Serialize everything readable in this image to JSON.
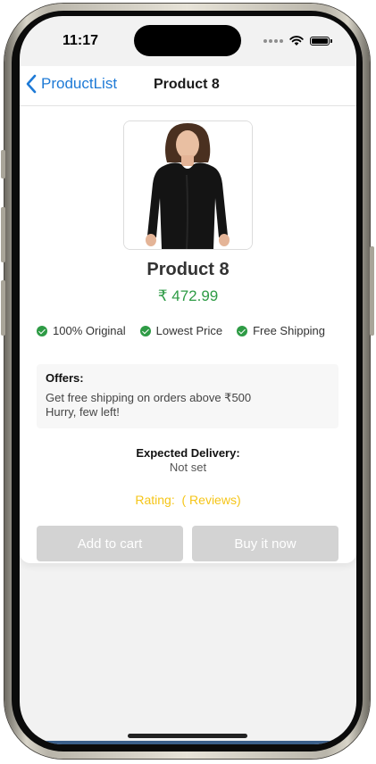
{
  "status_bar": {
    "time": "11:17",
    "icons": [
      "signal-dots-icon",
      "wifi-icon",
      "battery-icon"
    ]
  },
  "navbar": {
    "back_label": "ProductList",
    "title": "Product 8"
  },
  "product": {
    "image_icon": "black-long-sleeve-top-image",
    "name": "Product 8",
    "price": "₹ 472.99"
  },
  "features": [
    {
      "label": "100% Original",
      "icon": "check-circle-icon"
    },
    {
      "label": "Lowest Price",
      "icon": "check-circle-icon"
    },
    {
      "label": "Free Shipping",
      "icon": "check-circle-icon"
    }
  ],
  "offers": {
    "title": "Offers:",
    "line1": "Get free shipping on orders above ₹500",
    "line2": "Hurry, few left!"
  },
  "delivery": {
    "label": "Expected Delivery:",
    "value": "Not set"
  },
  "rating": {
    "text": "Rating:  ( Reviews)"
  },
  "actions": {
    "add_to_cart": "Add to cart",
    "buy_now": "Buy it now"
  },
  "colors": {
    "accent_blue": "#1e7ad6",
    "price_green": "#2e9b45",
    "rating_yellow": "#f5c518",
    "disabled_button": "#d3d3d3"
  }
}
